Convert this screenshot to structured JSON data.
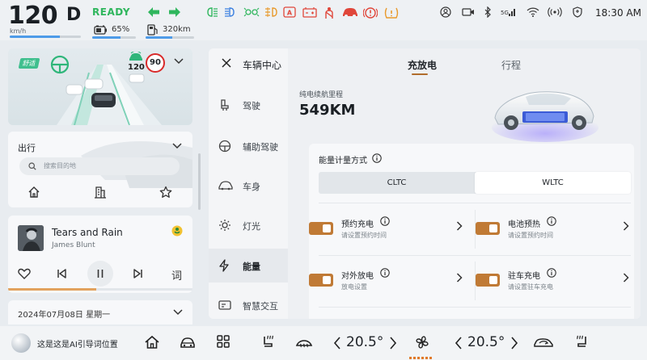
{
  "status": {
    "speed": "120",
    "speed_unit": "km/h",
    "speed_level": 0.7,
    "gear": "D",
    "ready": "READY",
    "battery": "65%",
    "battery_level": 0.65,
    "range": "320km",
    "range_level": 0.55,
    "time": "18:30 AM"
  },
  "adas": {
    "mode_tag": "舒适",
    "set_speed": "120",
    "speed_limit": "90"
  },
  "nav": {
    "title": "出行",
    "search_placeholder": "搜索目的地"
  },
  "music": {
    "title": "Tears and Rain",
    "artist": "James Blunt",
    "lyrics_label": "词",
    "progress": 0.48
  },
  "date": {
    "text": "2024年07月08日 星期一"
  },
  "panel": {
    "title": "车辆中心",
    "menu": [
      {
        "label": "驾驶"
      },
      {
        "label": "辅助驾驶"
      },
      {
        "label": "车身"
      },
      {
        "label": "灯光"
      },
      {
        "label": "能量"
      },
      {
        "label": "智慧交互"
      }
    ],
    "active_menu": "能量",
    "tabs": [
      {
        "label": "充放电"
      },
      {
        "label": "行程"
      }
    ],
    "active_tab": "充放电",
    "range_label": "纯电续航里程",
    "range_value": "549KM",
    "energy_mode_title": "能量计量方式",
    "energy_modes": [
      "CLTC",
      "WLTC"
    ],
    "selected_mode": "WLTC",
    "options": [
      {
        "title": "预约充电",
        "subtitle": "请设置预约时间"
      },
      {
        "title": "电池预热",
        "subtitle": "请设置预约时间"
      },
      {
        "title": "对外放电",
        "subtitle": "放电设置"
      },
      {
        "title": "驻车充电",
        "subtitle": "请设置驻车充电"
      }
    ]
  },
  "dock": {
    "ai_text": "这是这是AI引导词位置",
    "temp_left": "20.5°",
    "temp_right": "20.5°"
  },
  "colors": {
    "accent": "#c07a35",
    "ready": "#2fb65d",
    "warning": "#e0463a",
    "telltale_green": "#2fb65d",
    "telltale_orange": "#e89a2c"
  }
}
